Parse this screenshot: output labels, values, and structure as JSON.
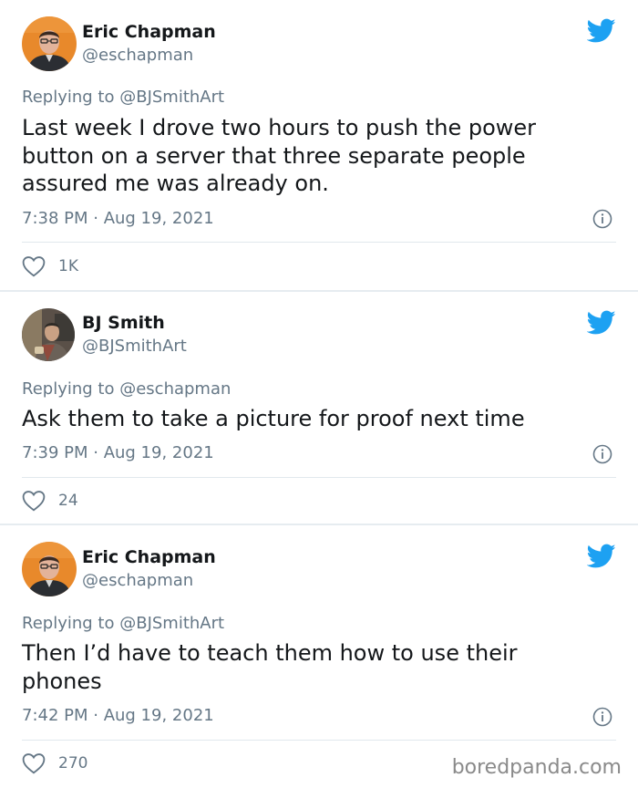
{
  "tweets": [
    {
      "name": "Eric Chapman",
      "handle": "@eschapman",
      "replying_prefix": "Replying to",
      "replying_to": "@BJSmithArt",
      "text": "Last week I drove two hours to push the power button on a server that three separate people assured me was already on.",
      "time": "7:38 PM · Aug 19, 2021",
      "likes": "1K"
    },
    {
      "name": "BJ Smith",
      "handle": "@BJSmithArt",
      "replying_prefix": "Replying to",
      "replying_to": "@eschapman",
      "text": "Ask them to take a picture for proof next time",
      "time": "7:39 PM · Aug 19, 2021",
      "likes": "24"
    },
    {
      "name": "Eric Chapman",
      "handle": "@eschapman",
      "replying_prefix": "Replying to",
      "replying_to": "@BJSmithArt",
      "text": "Then I’d have to teach them how to use their phones",
      "time": "7:42 PM · Aug 19, 2021",
      "likes": "270"
    }
  ],
  "watermark": "boredpanda.com",
  "colors": {
    "twitter_blue": "#1da1f2",
    "secondary_text": "#657786",
    "primary_text": "#14171a",
    "divider": "#e1e8ed",
    "background_gap": "#e6ecf0"
  },
  "icons": [
    "twitter-bird-icon",
    "info-icon",
    "heart-icon"
  ]
}
